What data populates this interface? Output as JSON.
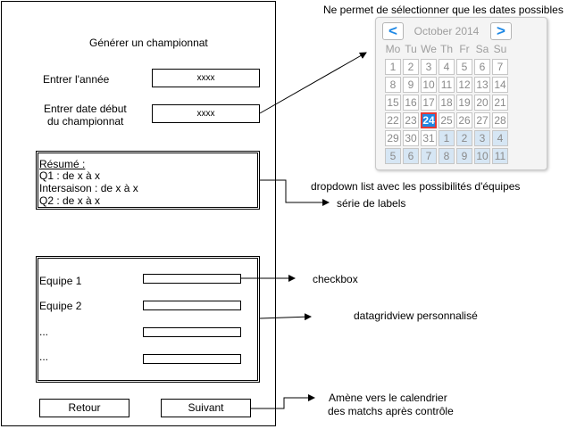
{
  "form": {
    "title": "Générer un championnat",
    "year_label": "Entrer l'année",
    "year_value": "xxxx",
    "start_label_line1": "Entrer date début",
    "start_label_line2": "du championnat",
    "start_value": "xxxx",
    "summary": {
      "heading": "Résumé :",
      "lines": [
        "Q1 : de x à x",
        "Intersaison : de x à x",
        "Q2 : de x à x"
      ]
    },
    "teams": [
      "Equipe 1",
      "Equipe 2",
      "...",
      "..."
    ],
    "back_label": "Retour",
    "next_label": "Suivant"
  },
  "calendar": {
    "caption": "Ne permet de sélectionner que les dates possibles",
    "month": "October 2014",
    "prev_glyph": "<",
    "next_glyph": ">",
    "weekdays": [
      "Mo",
      "Tu",
      "We",
      "Th",
      "Fr",
      "Sa",
      "Su"
    ],
    "weeks": [
      [
        "1",
        "2",
        "3",
        "4",
        "5",
        "6",
        "7"
      ],
      [
        "8",
        "9",
        "10",
        "11",
        "12",
        "13",
        "14"
      ],
      [
        "15",
        "16",
        "17",
        "18",
        "19",
        "20",
        "21"
      ],
      [
        "22",
        "23",
        "24",
        "25",
        "26",
        "27",
        "28"
      ],
      [
        "29",
        "30",
        "31",
        "1",
        "2",
        "3",
        "4"
      ],
      [
        "5",
        "6",
        "7",
        "8",
        "9",
        "10",
        "11"
      ]
    ],
    "selected": "24",
    "colors": {
      "accent": "#1e88e5",
      "selected_border": "#e53935",
      "outside_month": "#d6e6f4"
    }
  },
  "annotations": {
    "dropdown": "dropdown list avec les possibilités d'équipes",
    "labels": "série de labels",
    "checkbox": "checkbox",
    "datagrid": "datagridview personnalisé",
    "next_line1": "Amène vers le calendrier",
    "next_line2": "des matchs après contrôle"
  }
}
